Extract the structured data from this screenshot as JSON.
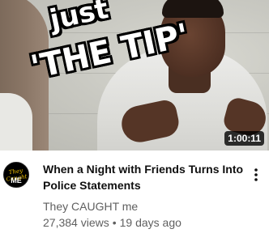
{
  "video": {
    "thumbnail": {
      "overlay_line1": "just",
      "overlay_line2": "'THE TIP'",
      "duration": "1:00:11"
    },
    "title_line1": "When a Night with Friends Turns Into",
    "title_line2": "Police Statements",
    "channel": "They CAUGHT me",
    "views": "27,384 views",
    "separator": "•",
    "age": "19 days ago",
    "avatar": {
      "line1": "They Caught",
      "line2": "ME"
    },
    "menu_icon": "more-vert-icon"
  },
  "colors": {
    "title": "#0f0f0f",
    "secondary_text": "#606060",
    "duration_bg": "#000000",
    "avatar_accent": "#f2c200"
  }
}
